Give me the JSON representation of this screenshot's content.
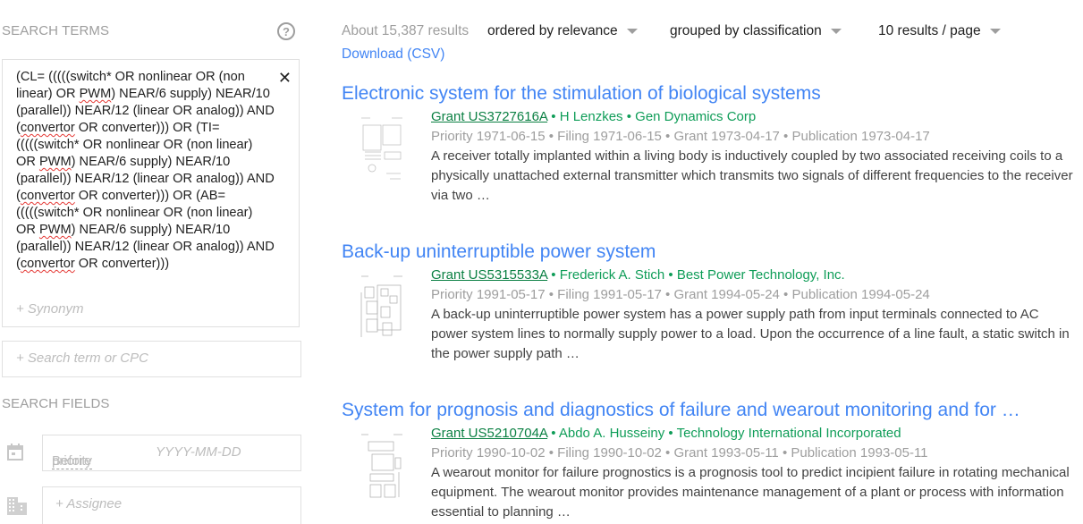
{
  "sidebar": {
    "search_terms_title": "SEARCH TERMS",
    "help_icon": "help-circle-icon",
    "query_segments": [
      {
        "t": "(CL= (((((switch* OR nonlinear OR (non linear) OR ",
        "sq": false
      },
      {
        "t": "PWM",
        "sq": true
      },
      {
        "t": ") NEAR/6 supply) NEAR/10 (parallel)) NEAR/12 (linear OR analog)) AND (",
        "sq": false
      },
      {
        "t": "convertor",
        "sq": true
      },
      {
        "t": " OR converter))) OR (TI= (((((switch* OR nonlinear OR (non linear) OR ",
        "sq": false
      },
      {
        "t": "PWM",
        "sq": true
      },
      {
        "t": ") NEAR/6 supply) NEAR/10 (parallel)) NEAR/12 (linear OR analog)) AND (",
        "sq": false
      },
      {
        "t": "convertor",
        "sq": true
      },
      {
        "t": " OR converter))) OR (AB= (((((switch* OR nonlinear OR (non linear) OR ",
        "sq": false
      },
      {
        "t": "PWM",
        "sq": true
      },
      {
        "t": ") NEAR/6 supply) NEAR/10 (parallel)) NEAR/12 (linear OR analog)) AND (",
        "sq": false
      },
      {
        "t": "convertor",
        "sq": true
      },
      {
        "t": " OR converter)))",
        "sq": false
      }
    ],
    "remove_icon": "close-icon",
    "close_glyph": "✕",
    "synonym_placeholder": "+ Synonym",
    "search_term_placeholder": "+ Search term or CPC",
    "search_fields_title": "SEARCH FIELDS",
    "before_priority_label": "Before priority",
    "date_placeholder": "YYYY-MM-DD",
    "assignee_placeholder": "+ Assignee"
  },
  "toolbar": {
    "result_count": "About 15,387 results",
    "order_by": "ordered by relevance",
    "group_by": "grouped by classification",
    "per_page": "10 results / page",
    "download": "Download (CSV)"
  },
  "colors": {
    "link": "#4285f4",
    "meta_green": "#0f9d58",
    "muted": "#9e9e9e"
  },
  "results": [
    {
      "title": "Electronic system for the stimulation of biological systems",
      "number": "Grant US3727616A",
      "sep": " • ",
      "inventor": "H Lenzkes",
      "assignee": "Gen Dynamics Corp",
      "dates": "Priority 1971-06-15 • Filing 1971-06-15 • Grant 1973-04-17 • Publication 1973-04-17",
      "snippet": "A receiver totally implanted within a living body is inductively coupled by two associated receiving coils to a physically unattached external transmitter which transmits two signals of different frequencies to the receiver via two …"
    },
    {
      "title": "Back-up uninterruptible power system",
      "number": "Grant US5315533A",
      "sep": " • ",
      "inventor": "Frederick A. Stich",
      "assignee": "Best Power Technology, Inc.",
      "dates": "Priority 1991-05-17 • Filing 1991-05-17 • Grant 1994-05-24 • Publication 1994-05-24",
      "snippet": "A back-up uninterruptible power system has a power supply path from input terminals connected to AC power system lines to normally supply power to a load. Upon the occurrence of a line fault, a static switch in the power supply path …"
    },
    {
      "title": "System for prognosis and diagnostics of failure and wearout monitoring and for …",
      "number": "Grant US5210704A",
      "sep": " • ",
      "inventor": "Abdo A. Husseiny",
      "assignee": "Technology International Incorporated",
      "dates": "Priority 1990-10-02 • Filing 1990-10-02 • Grant 1993-05-11 • Publication 1993-05-11",
      "snippet": "A wearout monitor for failure prognostics is a prognosis tool to predict incipient failure in rotating mechanical equipment. The wearout monitor provides maintenance management of a plant or process with information essential to planning …"
    }
  ]
}
